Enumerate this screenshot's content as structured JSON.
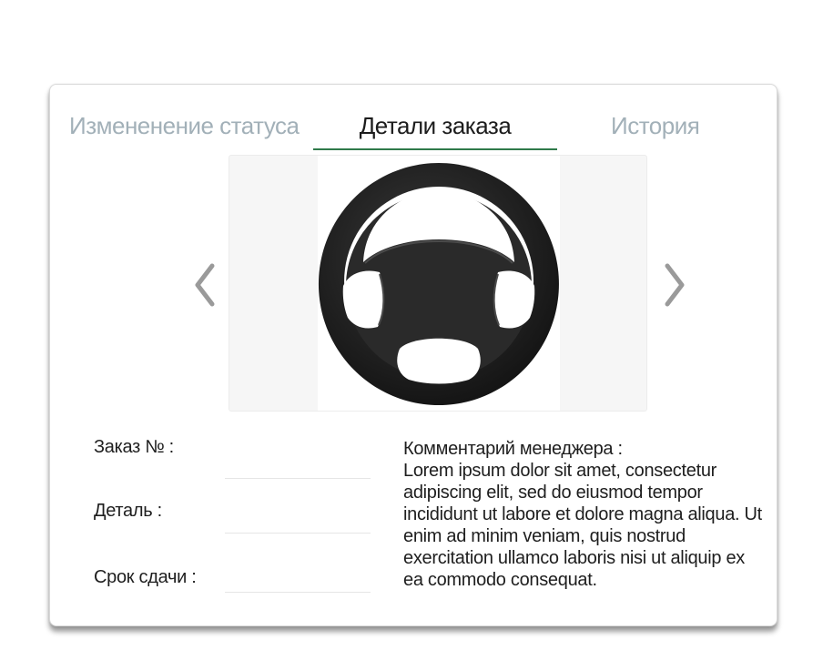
{
  "tabs": {
    "status_label": "Измененение статуса",
    "details_label": "Детали заказа",
    "history_label": "История"
  },
  "image": {
    "subject": "steering-wheel"
  },
  "order_fields": {
    "order_number_label": "Заказ № :",
    "order_number_value": "",
    "part_label": "Деталь :",
    "part_value": "",
    "deadline_label": "Срок сдачи :",
    "deadline_value": ""
  },
  "comment": {
    "title": "Комментарий менеджера :",
    "text": "Lorem ipsum dolor sit amet, consectetur adipiscing elit, sed do eiusmod tempor incididunt ut labore et dolore magna aliqua. Ut enim ad minim veniam, quis nostrud exercitation ullamco laboris nisi ut aliquip ex ea commodo consequat."
  },
  "colors": {
    "active_tab_underline": "#2f7a4a",
    "inactive_tab_text": "#a2b0b8",
    "arrow": "#9a9a9a"
  },
  "icons": {
    "prev": "chevron-left-icon",
    "next": "chevron-right-icon"
  }
}
